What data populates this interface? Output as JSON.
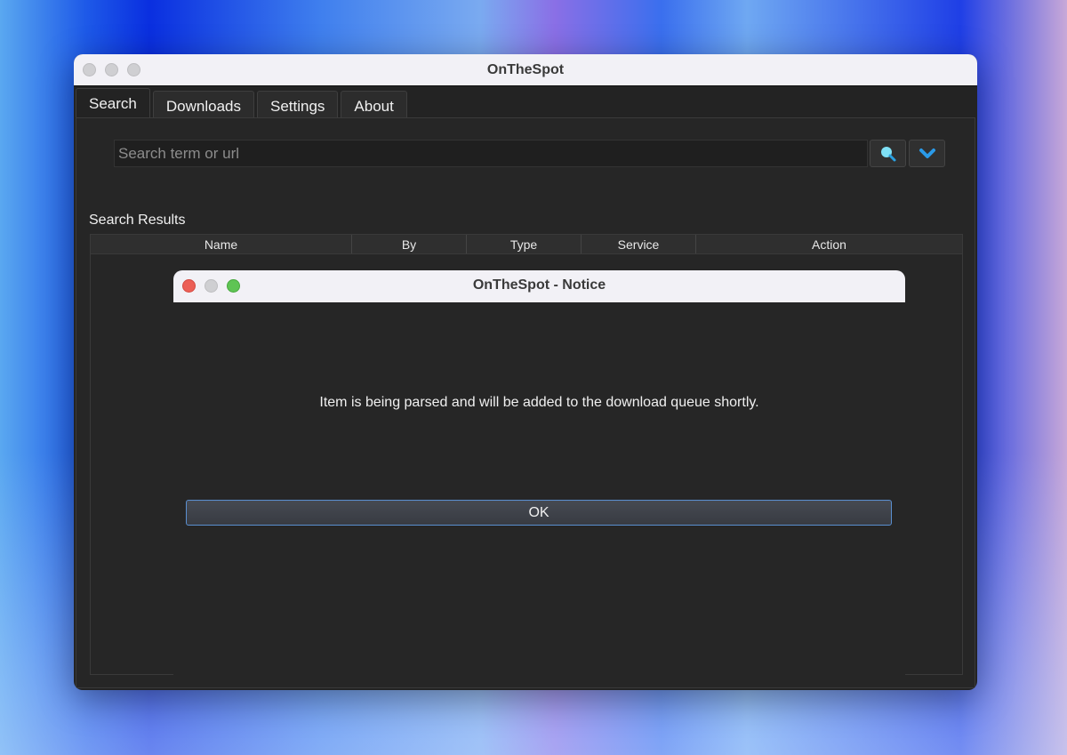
{
  "window": {
    "title": "OnTheSpot"
  },
  "tabs": [
    {
      "label": "Search"
    },
    {
      "label": "Downloads"
    },
    {
      "label": "Settings"
    },
    {
      "label": "About"
    }
  ],
  "search": {
    "placeholder": "Search term or url",
    "search_icon": "search-icon",
    "menu_icon": "chevron-down-icon"
  },
  "results": {
    "label": "Search Results",
    "columns": [
      "Name",
      "By",
      "Type",
      "Service",
      "Action"
    ]
  },
  "dialog": {
    "title": "OnTheSpot - Notice",
    "message": "Item is being parsed and will be added to the download queue shortly.",
    "ok_label": "OK"
  }
}
